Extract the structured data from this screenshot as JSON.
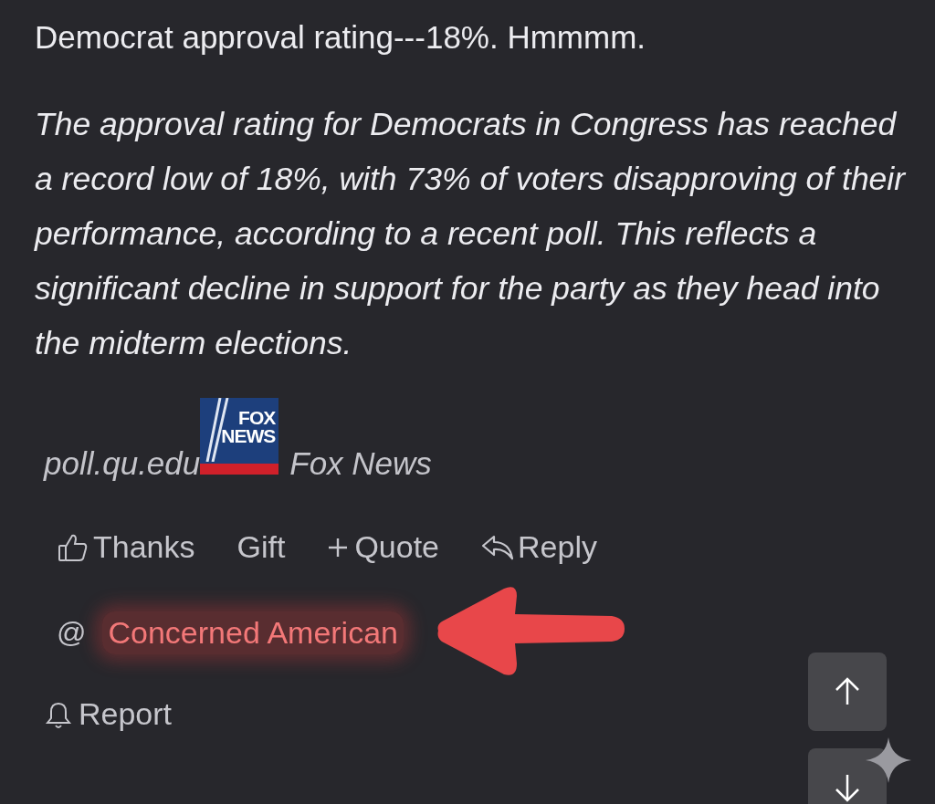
{
  "post": {
    "title": "Democrat approval rating---18%. Hmmmm.",
    "quote": "The approval rating for Democrats in Congress has reached a record low of 18%, with 73% of voters disapproving of their performance, according to a recent poll. This reflects a significant decline in support for the party as they head into the midterm elections.",
    "source": {
      "domain": "poll.qu.edu",
      "logo_lines": [
        "FOX",
        "NEWS"
      ],
      "publisher": "Fox News"
    }
  },
  "actions": [
    {
      "kind": "thanks",
      "label": "Thanks"
    },
    {
      "kind": "gift",
      "label": "Gift"
    },
    {
      "kind": "quote",
      "label": "Quote"
    },
    {
      "kind": "reply",
      "label": "Reply"
    }
  ],
  "mention": {
    "symbol": "@",
    "name": "Concerned American",
    "highlighted": true
  },
  "report": {
    "label": "Report"
  }
}
